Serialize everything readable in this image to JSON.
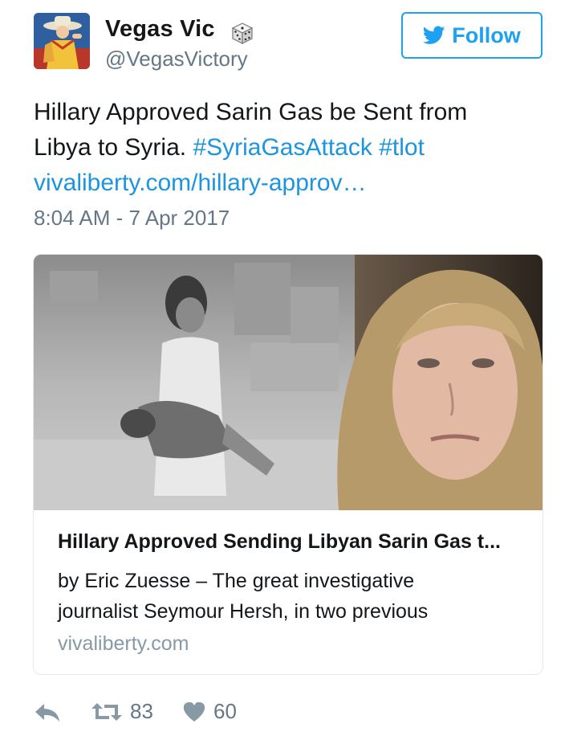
{
  "user": {
    "name": "Vegas Vic",
    "handle": "@VegasVictory",
    "badge_icon": "dice-icon"
  },
  "follow_button": {
    "label": "Follow",
    "icon": "twitter-bird-icon",
    "color": "#1da1f2"
  },
  "tweet": {
    "text_line1": "Hillary Approved Sarin Gas be Sent from",
    "text_line2_plain": "Libya to Syria. ",
    "hashtag1": "#SyriaGasAttack",
    "hashtag2": "#tlot",
    "link": "vivaliberty.com/hillary-approv…",
    "timestamp": "8:04 AM - 7 Apr 2017",
    "link_color": "#1b95e0"
  },
  "card": {
    "title": "Hillary Approved Sending Libyan Sarin Gas t...",
    "description_line1": "by Eric Zuesse – The great investigative",
    "description_line2": "journalist Seymour Hersh, in two previous",
    "domain": "vivaliberty.com"
  },
  "actions": {
    "reply_icon": "reply-icon",
    "retweet_icon": "retweet-icon",
    "retweet_count": "83",
    "like_icon": "heart-icon",
    "like_count": "60"
  }
}
